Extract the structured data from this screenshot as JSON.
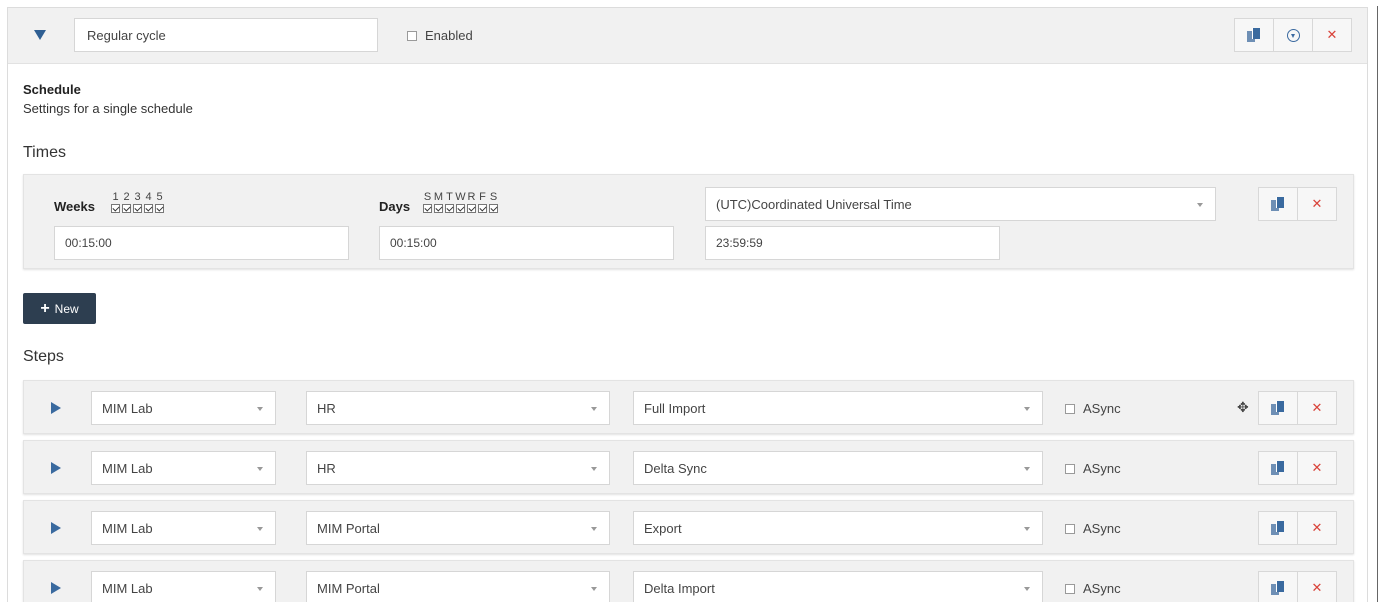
{
  "header": {
    "name_value": "Regular cycle",
    "enabled_label": "Enabled"
  },
  "schedule": {
    "title": "Schedule",
    "description": "Settings for a single schedule"
  },
  "times": {
    "title": "Times",
    "weeks_label": "Weeks",
    "weeks": [
      "1",
      "2",
      "3",
      "4",
      "5"
    ],
    "days_label": "Days",
    "days": [
      "S",
      "M",
      "T",
      "W",
      "R",
      "F",
      "S"
    ],
    "timezone": "(UTC)Coordinated Universal Time",
    "interval_value": "00:15:00",
    "start_value": "00:15:00",
    "end_value": "23:59:59"
  },
  "new_button_label": "New",
  "steps": {
    "title": "Steps",
    "async_label": "ASync",
    "rows": [
      {
        "server": "MIM Lab",
        "agent": "HR",
        "run_profile": "Full Import"
      },
      {
        "server": "MIM Lab",
        "agent": "HR",
        "run_profile": "Delta Sync"
      },
      {
        "server": "MIM Lab",
        "agent": "MIM Portal",
        "run_profile": "Export"
      },
      {
        "server": "MIM Lab",
        "agent": "MIM Portal",
        "run_profile": "Delta Import"
      }
    ]
  },
  "icons": {
    "collapse": "triangle-down-icon",
    "expand": "triangle-right-icon",
    "copy": "copy-icon",
    "download": "download-circle-icon",
    "delete": "close-icon",
    "move": "move-arrows-icon"
  },
  "colors": {
    "accent": "#2f5f93",
    "danger": "#d9433a",
    "new_button": "#2d3e50",
    "panel_bg": "#f1f1f1"
  }
}
